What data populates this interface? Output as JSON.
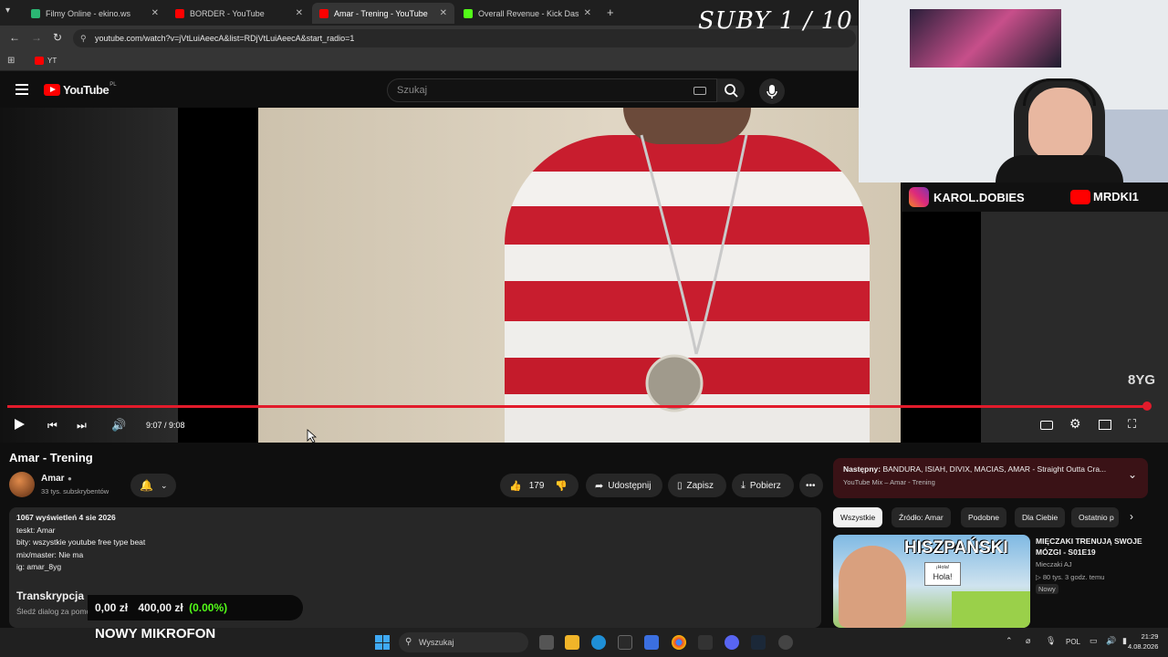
{
  "browser": {
    "tabs": [
      {
        "title": "Filmy Online - ekino.ws",
        "color": "#2bb673"
      },
      {
        "title": "BORDER - YouTube",
        "color": "#ff0000"
      },
      {
        "title": "Amar - Trening - YouTube",
        "color": "#ff0000",
        "active": true
      },
      {
        "title": "Overall Revenue - Kick Dashbo...",
        "color": "#53fc18"
      }
    ],
    "url": "youtube.com/watch?v=jVtLuiAeecA&list=RDjVtLuiAeecA&start_radio=1",
    "bookmark": "YT"
  },
  "youtube": {
    "logo": "YouTube",
    "region": "PL",
    "search_placeholder": "Szukaj"
  },
  "overlay": {
    "subs": "SUBY 1 / 10",
    "instagram": "KAROL.DOBIES",
    "youtube_handle": "MRDKI1",
    "money_value": "0,00 zł",
    "money_goal": "400,00 zł",
    "money_pct": "(0.00%)",
    "banner": "NOWY MIKROFON"
  },
  "player": {
    "time": "9:07 / 9:08",
    "watermark": "8YG",
    "progress": 0.998
  },
  "video": {
    "title": "Amar - Trening",
    "channel": "Amar",
    "subscribers": "33 tys. subskrybentów",
    "likes": "179",
    "share": "Udostępnij",
    "save": "Zapisz",
    "download": "Pobierz"
  },
  "description": {
    "meta": "1067 wyświetleń  4 sie 2026",
    "lines": [
      "teskt: Amar",
      "bity: wszystkie youtube free type beat",
      "mix/master: Nie ma",
      "ig: amar_8yg"
    ],
    "transcript_title": "Transkrypcja",
    "transcript_sub": "Śledź dialog za pomocą transkrypcji."
  },
  "sidebar": {
    "next_label": "Następny:",
    "next_title": "BANDURA, ISIAH, DIVIX, MACIAS, AMAR - Straight Outta Cra...",
    "next_sub": "YouTube Mix – Amar - Trening",
    "chips": [
      "Wszystkie",
      "Źródło: Amar",
      "Podobne",
      "Dla Ciebie",
      "Ostatnio p"
    ],
    "rec": {
      "title": "MIĘCZAKI TRENUJĄ SWOJE MÓZGI - S01E19",
      "channel": "Mieczaki AJ",
      "meta": "80 tys.  3 godz. temu",
      "badge": "Nowy",
      "thumb_text": "HISZPAŃSKI",
      "sign_top": "¡Hola!",
      "sign_text": "Hola!"
    }
  },
  "taskbar": {
    "search": "Wyszukaj",
    "lang": "POL",
    "time": "21:29",
    "date": "4.08.2026"
  }
}
